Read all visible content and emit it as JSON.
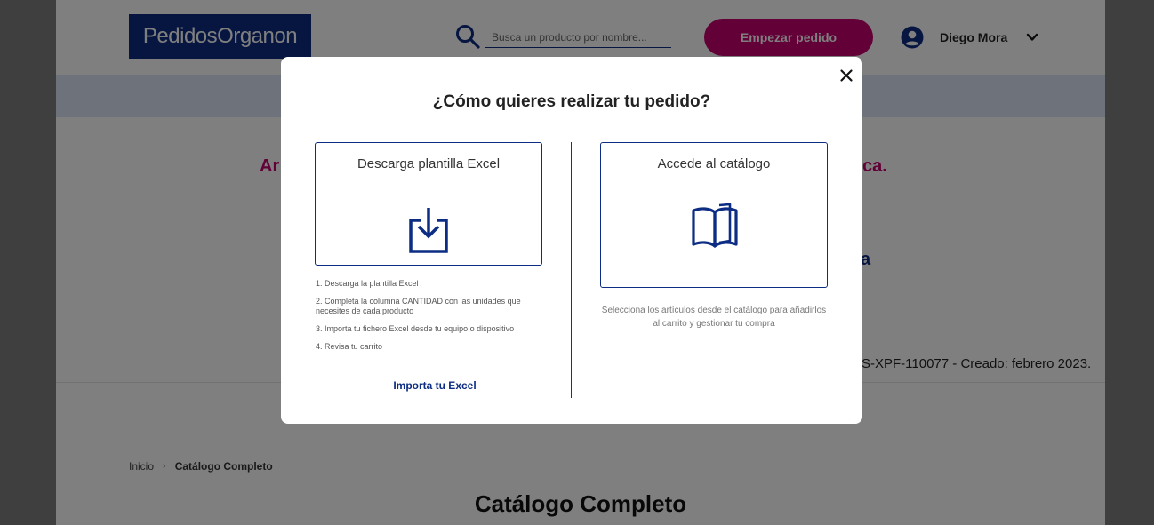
{
  "header": {
    "logo_text": "PedidosOrganon",
    "search_placeholder": "Busca un producto por nombre...",
    "start_order_label": "Empezar pedido",
    "user_name": "Diego Mora"
  },
  "background": {
    "headline_left": "Ar",
    "headline_right": "ca.",
    "product_fragment": "a",
    "reference_text": "S-XPF-110077 - Creado: febrero 2023.",
    "breadcrumb": [
      "Inicio",
      "Catálogo Completo"
    ],
    "page_title": "Catálogo Completo"
  },
  "modal": {
    "title": "¿Cómo quieres realizar tu pedido?",
    "excel_option": {
      "label": "Descarga plantilla Excel",
      "icon": "download-icon",
      "steps": [
        "1. Descarga la plantilla Excel",
        "2. Completa la columna CANTIDAD con las unidades que necesites de cada producto",
        "3. Importa tu fichero Excel desde tu equipo o dispositivo",
        "4. Revisa tu carrito"
      ],
      "import_link": "Importa tu Excel"
    },
    "catalog_option": {
      "label": "Accede al catálogo",
      "icon": "book-icon",
      "description": "Selecciona los artículos desde el catálogo para añadirlos al carrito y gestionar tu compra"
    }
  },
  "colors": {
    "brand_blue": "#0c2d83",
    "accent_magenta": "#c4006e",
    "banner": "#dbe4f6"
  }
}
